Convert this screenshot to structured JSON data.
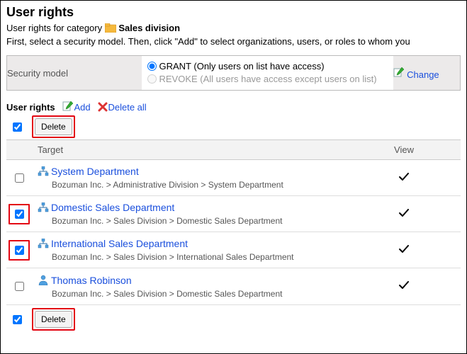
{
  "page_title": "User rights",
  "category": {
    "prefix": "User rights for category ",
    "name": "Sales division"
  },
  "description": "First, select a security model. Then, click \"Add\" to select organizations, users, or roles to whom you",
  "security_model": {
    "label": "Security model",
    "options": {
      "grant": "GRANT (Only users on list have access)",
      "revoke": "REVOKE (All users have access except users on list)"
    },
    "change": "Change"
  },
  "section_label": "User rights",
  "actions": {
    "add": "Add",
    "delete_all": "Delete all",
    "delete": "Delete"
  },
  "table": {
    "header_target": "Target",
    "header_view": "View",
    "rows": [
      {
        "type": "org",
        "name": "System Department",
        "path": "Bozuman Inc. > Administrative Division > System Department",
        "checked": false,
        "highlight": false,
        "view": true
      },
      {
        "type": "org",
        "name": "Domestic Sales Department",
        "path": "Bozuman Inc. > Sales Division > Domestic Sales Department",
        "checked": true,
        "highlight": true,
        "view": true
      },
      {
        "type": "org",
        "name": "International Sales Department",
        "path": "Bozuman Inc. > Sales Division > International Sales Department",
        "checked": true,
        "highlight": true,
        "view": true
      },
      {
        "type": "user",
        "name": "Thomas Robinson",
        "path": "Bozuman Inc. > Sales Division > Domestic Sales Department",
        "checked": false,
        "highlight": false,
        "view": true
      }
    ]
  }
}
